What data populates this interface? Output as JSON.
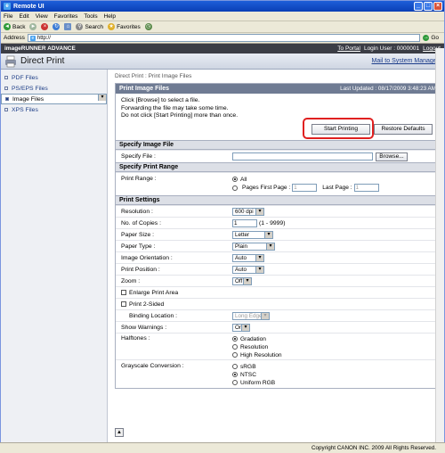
{
  "window": {
    "title": "Remote UI"
  },
  "menu": [
    "File",
    "Edit",
    "View",
    "Favorites",
    "Tools",
    "Help"
  ],
  "toolbar": {
    "back": "Back",
    "search": "Search",
    "favorites": "Favorites"
  },
  "address": {
    "label": "Address",
    "value": "http://",
    "go": "Go"
  },
  "app": {
    "brand": "imageRUNNER ADVANCE",
    "to_portal": "To Portal",
    "login_user": "Login User : 0000001",
    "logout": "Logout"
  },
  "page": {
    "title": "Direct Print",
    "mail": "Mail to System Manager"
  },
  "sidebar": {
    "items": [
      {
        "label": "PDF Files"
      },
      {
        "label": "PS/EPS Files"
      },
      {
        "label": "Image Files"
      },
      {
        "label": "XPS Files"
      }
    ]
  },
  "breadcrumb": {
    "a": "Direct Print",
    "sep": ":",
    "b": "Print Image Files"
  },
  "panel": {
    "title": "Print Image Files",
    "updated": "Last Updated : 08/17/2009 3:48:23 AM",
    "info": [
      "Click [Browse] to select a file.",
      "Forwarding the file may take some time.",
      "Do not click [Start Printing] more than once."
    ],
    "start": "Start Printing",
    "restore": "Restore Defaults"
  },
  "specify": {
    "section": "Specify Image File",
    "label": "Specify File :",
    "browse": "Browse..."
  },
  "range": {
    "section": "Specify Print Range",
    "label": "Print Range :",
    "all": "All",
    "pages": "Pages First Page :",
    "first": "1",
    "last_label": "Last Page :",
    "last": "1"
  },
  "settings": {
    "section": "Print Settings",
    "resolution_label": "Resolution :",
    "resolution": "600 dpi",
    "copies_label": "No. of Copies :",
    "copies": "1",
    "copies_range": "(1 - 9999)",
    "paper_size_label": "Paper Size :",
    "paper_size": "Letter",
    "paper_type_label": "Paper Type :",
    "paper_type": "Plain",
    "orientation_label": "Image Orientation :",
    "orientation": "Auto",
    "position_label": "Print Position :",
    "position": "Auto",
    "zoom_label": "Zoom :",
    "zoom": "Off",
    "enlarge": "Enlarge Print Area",
    "two_sided": "Print 2-Sided",
    "binding_label": "Binding Location :",
    "binding": "Long Edge",
    "warnings_label": "Show Warnings :",
    "warnings": "On",
    "halftones_label": "Halftones :",
    "halftones": [
      "Gradation",
      "Resolution",
      "High Resolution"
    ],
    "grayscale_label": "Grayscale Conversion :",
    "grayscale": [
      "sRGB",
      "NTSC",
      "Uniform RGB"
    ]
  },
  "footer": {
    "copyright": "Copyright CANON INC. 2009 All Rights Reserved."
  }
}
